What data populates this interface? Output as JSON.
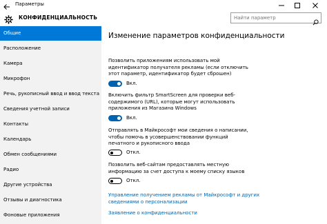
{
  "window": {
    "title": "Параметры"
  },
  "header": {
    "title": "КОНФИДЕНЦИАЛЬНОСТЬ",
    "search_placeholder": "Найти параметр"
  },
  "sidebar": {
    "items": [
      {
        "label": "Общие",
        "active": true
      },
      {
        "label": "Расположение"
      },
      {
        "label": "Камера"
      },
      {
        "label": "Микрофон"
      },
      {
        "label": "Речь, рукописный ввод и ввод текста"
      },
      {
        "label": "Сведения учетной записи"
      },
      {
        "label": "Контакты"
      },
      {
        "label": "Календарь"
      },
      {
        "label": "Обмен сообщениями"
      },
      {
        "label": "Радио"
      },
      {
        "label": "Другие устройства"
      },
      {
        "label": "Отзывы и диагностика"
      },
      {
        "label": "Фоновые приложения"
      }
    ]
  },
  "main": {
    "heading": "Изменение параметров конфиденциальности",
    "settings": [
      {
        "description": "Позволить приложениям использовать мой идентификатор получателя рекламы (если отключить этот параметр, идентификатор будет сброшен)",
        "state": "on",
        "state_label": "Вкл."
      },
      {
        "description": "Включить фильтр SmartScreen для проверки веб-содержимого (URL), которые могут использовать приложения из Магазина Windows",
        "state": "on",
        "state_label": "Вкл."
      },
      {
        "description": "Отправлять в Майкрософт мои сведения о написании, чтобы помочь в усовершенствовании функций печатного и рукописного ввода",
        "state": "off",
        "state_label": "Откл."
      },
      {
        "description": "Позволить веб-сайтам предоставлять местную информацию за счет доступа к моему списку языков",
        "state": "off",
        "state_label": "Откл."
      }
    ],
    "links": [
      "Управление получением рекламы от Майкрософт и других сведениями о персонализации",
      "Заявление о конфиденциальности"
    ]
  },
  "colors": {
    "accent": "#0078d7",
    "toggle_on": "#0063b1",
    "sidebar_bg": "#f2f2f2",
    "link": "#0063b1"
  }
}
